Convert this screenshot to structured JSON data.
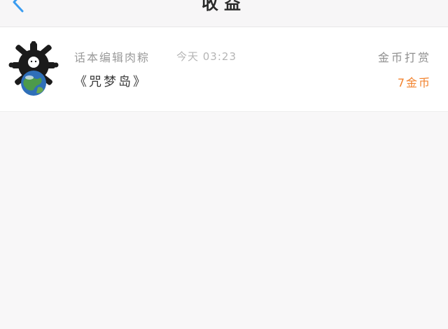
{
  "header": {
    "title": "收益",
    "back_icon": "chevron-left-icon",
    "accent_color": "#3a9cf0"
  },
  "records": [
    {
      "username": "话本编辑肉粽",
      "timestamp": "今天 03:23",
      "title": "《咒梦岛》",
      "reward_type": "金币打赏",
      "reward_amount": "7金币",
      "amount_color": "#f2822c"
    }
  ]
}
